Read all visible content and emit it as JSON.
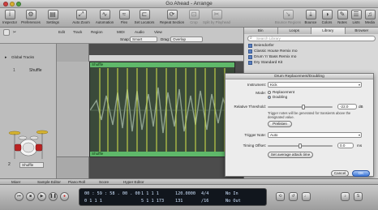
{
  "window": {
    "title": "Go Ahead - Arrange"
  },
  "toolbar": {
    "left": [
      {
        "label": "Inspector",
        "icon": "i"
      },
      {
        "label": "Preferences",
        "icon": "⚙"
      },
      {
        "label": "Settings",
        "icon": "▤"
      }
    ],
    "mid": [
      {
        "label": "Auto Zoom",
        "icon": "⤢"
      },
      {
        "label": "Automation",
        "icon": "∿"
      },
      {
        "label": "Flex",
        "icon": "≈"
      },
      {
        "label": "Set Locators",
        "icon": "⊏"
      },
      {
        "label": "Repeat Section",
        "icon": "⟳"
      },
      {
        "label": "Crop",
        "icon": "⊡"
      },
      {
        "label": "Split by Playhead",
        "icon": "✂"
      }
    ],
    "right": [
      {
        "label": "Bounce Regions",
        "icon": "↘"
      },
      {
        "label": "Bounce",
        "icon": "⤓"
      },
      {
        "label": "Colors",
        "icon": "◑"
      },
      {
        "label": "Notes",
        "icon": "✎"
      },
      {
        "label": "Lists",
        "icon": "☰"
      },
      {
        "label": "Media",
        "icon": "♫"
      }
    ]
  },
  "editbar": {
    "menus": [
      "Edit",
      "Track",
      "Region",
      "MIDI",
      "Audio",
      "View"
    ],
    "snap_label": "Snap:",
    "snap_value": "Smart",
    "drag_label": "Drag:",
    "drag_value": "Overlap"
  },
  "inspector": {
    "global_tracks": "Global Tracks",
    "track_number": "1",
    "track_name": "Shuffle",
    "footer_number": "2",
    "footer_name": "Shuffle"
  },
  "arrange": {
    "region_name_top": "Shuffle",
    "region_name_bottom": "Shuffle"
  },
  "side": {
    "tabs": [
      "Bin",
      "Loops",
      "Library",
      "Browser"
    ],
    "active_tab": "Library",
    "search_placeholder": "Search Library",
    "items": [
      "Beiendorfer",
      "Classic House Remix mo",
      "Drum 'n' Bass Remix mo",
      "Dry Standard Kit"
    ]
  },
  "dialog": {
    "title": "Drum Replacement/Doubling",
    "instrument_label": "Instrument:",
    "instrument_value": "Kick",
    "mode_label": "Mode:",
    "mode_options": [
      "Replacement",
      "Doubling"
    ],
    "mode_selected": "Doubling",
    "threshold_label": "Relative Threshold:",
    "threshold_value": "-22.0",
    "threshold_unit": "dB",
    "threshold_level": 0.55,
    "note_line1": "Trigger notes will be generated for transients above the",
    "note_line2": "designated value.",
    "prelisten_label": "Prelisten",
    "trigger_label": "Trigger Note:",
    "trigger_value": "Auto",
    "offset_label": "Timing Offset:",
    "offset_value": "0.0",
    "offset_unit": "ms",
    "offset_level": 0.5,
    "attack_button": "Set average attack time",
    "cancel": "Cancel",
    "ok": "OK"
  },
  "bottom_tabs": [
    "Mixer",
    "Sample Editor",
    "Piano Roll",
    "Score",
    "Hyper Editor"
  ],
  "transport": {
    "position_top": "00 : 59 : 58 . 00 . 00",
    "position_bottom": "0   1   1   1",
    "bars_top": "1   1   1   1",
    "bars_bottom": "5   1   1   173",
    "tempo": "120.0000",
    "tempo2": "131",
    "sig_top": "4/4",
    "sig_bottom": "/16",
    "in_text": "No In",
    "out_text": "No Out"
  }
}
